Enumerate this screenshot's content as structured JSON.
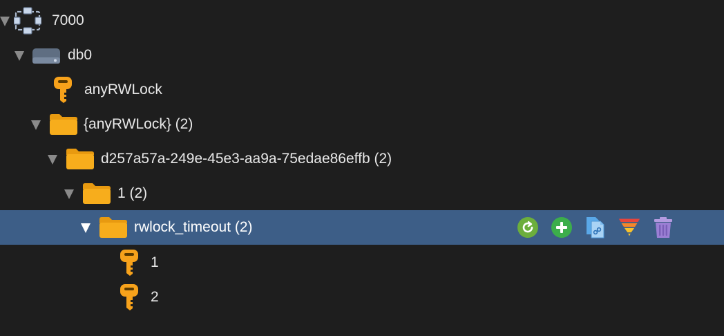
{
  "tree": {
    "nodes": [
      {
        "label": "7000",
        "icon": "server-cluster-icon"
      },
      {
        "label": "db0",
        "icon": "database-disk-icon"
      },
      {
        "label": "anyRWLock",
        "icon": "key-icon"
      },
      {
        "label": "{anyRWLock} (2)",
        "icon": "folder-icon"
      },
      {
        "label": "d257a57a-249e-45e3-aa9a-75edae86effb (2)",
        "icon": "folder-icon"
      },
      {
        "label": "1 (2)",
        "icon": "folder-icon"
      },
      {
        "label": "rwlock_timeout (2)",
        "icon": "folder-icon"
      },
      {
        "label": "1",
        "icon": "key-icon"
      },
      {
        "label": "2",
        "icon": "key-icon"
      }
    ],
    "selected_index": 6,
    "actions": [
      {
        "name": "refresh",
        "icon": "refresh-icon",
        "color": "#6cae3c"
      },
      {
        "name": "add",
        "icon": "plus-circle-icon",
        "color": "#3cae4b"
      },
      {
        "name": "copy-link",
        "icon": "copy-link-icon",
        "color": "#5aa8e8"
      },
      {
        "name": "filter",
        "icon": "filter-funnel-icon",
        "color": "#f05a28"
      },
      {
        "name": "delete",
        "icon": "trash-icon",
        "color": "#9b7fd4"
      }
    ]
  },
  "colors": {
    "background": "#1e1e1e",
    "selected_row": "#3d5e87",
    "folder": "#f7ad1c",
    "key": "#f7a21b"
  }
}
